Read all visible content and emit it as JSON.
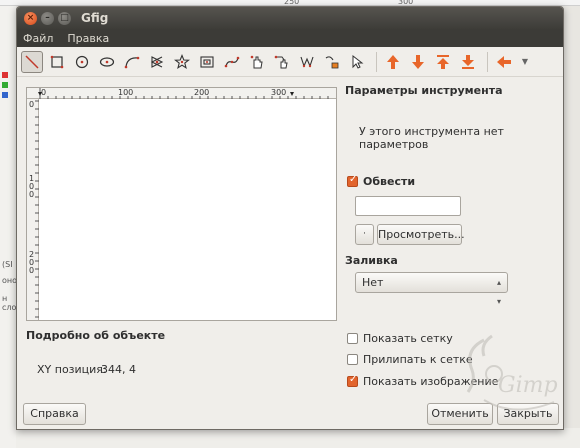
{
  "window": {
    "title": "Gfig"
  },
  "menu": [
    "Файл",
    "Правка"
  ],
  "toolbar": {
    "tools": [
      "line-tool",
      "rectangle-tool",
      "circle-tool",
      "ellipse-tool",
      "arc-tool",
      "polygon-tool",
      "star-tool",
      "spiral-tool",
      "bezier-tool",
      "move-object-tool",
      "move-point-tool",
      "copy-object-tool",
      "delete-object-tool",
      "select-object-tool"
    ],
    "order": [
      "raise-object",
      "lower-object",
      "raise-to-top",
      "lower-to-bottom",
      "show-previous"
    ]
  },
  "ruler": {
    "h": [
      "0",
      "100",
      "200",
      "300"
    ],
    "v": [
      "0",
      "1\n0\n0",
      "2\n0\n0"
    ]
  },
  "tool_params": {
    "title": "Параметры инструмента",
    "message": "У этого инструмента нет параметров"
  },
  "stroke": {
    "label": "Обвести",
    "checked": true,
    "browse_label": "Просмотреть..."
  },
  "fill": {
    "label": "Заливка",
    "selected": "Нет"
  },
  "grid": {
    "show_grid": "Показать сетку",
    "snap_grid": "Прилипать к сетке",
    "show_image": "Показать изображение"
  },
  "object_details": {
    "title": "Подробно об объекте",
    "xy_label": "XY позиция:",
    "xy_value": "344, 4"
  },
  "buttons": {
    "help": "Справка",
    "cancel": "Отменить",
    "close": "Закрыть"
  },
  "background": {
    "top_ruler": [
      "250",
      "300"
    ],
    "left_text": [
      "(SI",
      "оново",
      "н сло"
    ]
  },
  "watermark": "Gimp"
}
